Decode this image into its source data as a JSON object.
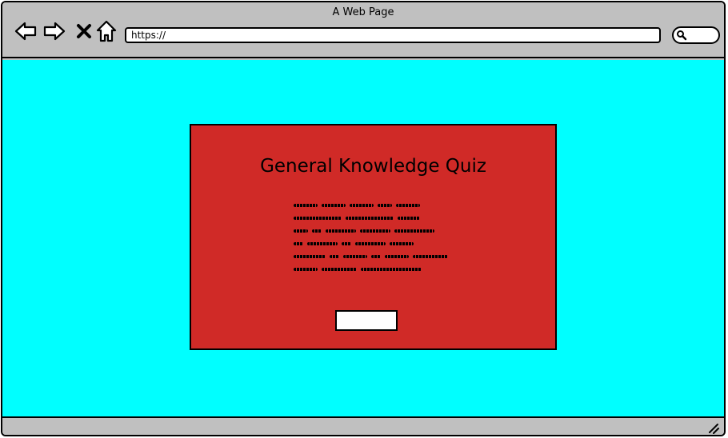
{
  "window": {
    "title": "A Web Page"
  },
  "toolbar": {
    "back_icon": "arrow-left-icon",
    "forward_icon": "arrow-right-icon",
    "stop_icon": "close-x-icon",
    "home_icon": "home-icon",
    "url_value": "https://",
    "search_icon": "magnifier-icon"
  },
  "page": {
    "background_color": "#00ffff",
    "card": {
      "background_color": "#d02a27",
      "title": "General Knowledge Quiz",
      "body_placeholder_lines": 6,
      "button_label": ""
    }
  },
  "colors": {
    "chrome": "#c0c0c0",
    "content_bg": "#00ffff",
    "card_bg": "#d02a27"
  }
}
